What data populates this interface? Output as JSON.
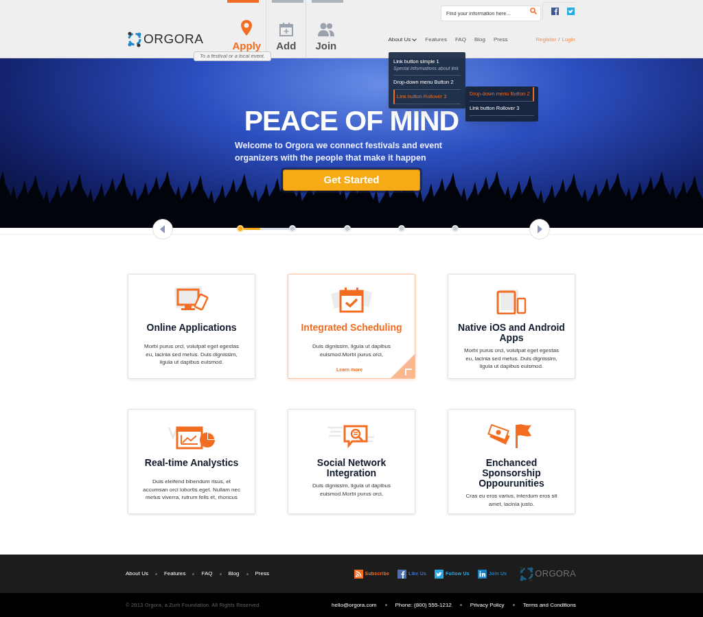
{
  "header": {
    "logo": "ORGORA",
    "actions": [
      {
        "label": "Apply",
        "selected": true
      },
      {
        "label": "Add",
        "selected": false
      },
      {
        "label": "Join",
        "selected": false
      }
    ],
    "tooltip": "To a festival or a local event.",
    "search": {
      "placeholder": "Find your information here..."
    },
    "nav": [
      {
        "label": "About Us",
        "expanded": true
      },
      {
        "label": "Features",
        "expanded": false
      },
      {
        "label": "FAQ",
        "expanded": false
      },
      {
        "label": "Blog",
        "expanded": false
      },
      {
        "label": "Press",
        "expanded": false
      }
    ],
    "auth": {
      "register": "Register",
      "separator": "/",
      "login": "Login"
    },
    "dropdown": {
      "items": [
        {
          "label": "Link button simple 1",
          "subtitle": "Special informations about link",
          "selected": false
        },
        {
          "label": "Drop-down menu Button 2",
          "selected": false
        },
        {
          "label": "Link button Rollover 3",
          "selected": true
        }
      ],
      "submenu": [
        {
          "label": "Drop-down menu Button 2",
          "selected": true
        },
        {
          "label": "Link button Rollover 3",
          "selected": false
        }
      ]
    }
  },
  "hero": {
    "title": "PEACE OF MIND",
    "subtitle": "Welcome to Orgora we connect festivals and event organizers with the people that make it happen",
    "button": "Get Started"
  },
  "slider": {
    "level": 0.37,
    "slides": [
      {
        "selected": true
      },
      {
        "selected": false
      },
      {
        "selected": false
      },
      {
        "selected": false
      },
      {
        "selected": false
      }
    ]
  },
  "features": [
    {
      "title": "Online Applications",
      "text": "Morbi purus orci, volutpat eget egestas eu, lacinia sed metus. Duis dignissim, ligula ut dapibus euismod.",
      "selected": false
    },
    {
      "title": "Integrated Scheduling",
      "text": "Duis dignissim, ligula ut dapibus euismod.Morbi purus orci,",
      "link": "Learn more",
      "selected": true
    },
    {
      "title": "Native iOS and Android Apps",
      "text": "Morbi purus orci, volutpat eget egestas eu, lacinia sed metus. Duis dignissim, ligula ut dapibus euismod.",
      "selected": false
    },
    {
      "title": "Real-time Analystics",
      "text": "Duis eleifend bibendum risus, et accumsan orci lobortis eget. Nullam nec metus viverra, rutrum felis et, rhoncus",
      "selected": false
    },
    {
      "title": "Social Network Integration",
      "text": "Duis dignissim, ligula ut dapibus euismod.Morbi purus orci,",
      "selected": false
    },
    {
      "title": "Enchanced Sponsorship Oppourunities",
      "text": "Cras eu eros varius, interdum eros sit amet, lacinia justo.",
      "selected": false
    }
  ],
  "footer": {
    "nav": [
      "About Us",
      "Features",
      "FAQ",
      "Blog",
      "Press"
    ],
    "social": [
      {
        "kind": "rss",
        "label": "Subscribe",
        "color": "#f26d21"
      },
      {
        "kind": "facebook",
        "label": "Like Us",
        "color": "#4a6fb5"
      },
      {
        "kind": "twitter",
        "label": "Follow Us",
        "color": "#29a9e1"
      },
      {
        "kind": "linkedin",
        "label": "Join Us",
        "color": "#1b7fc4"
      }
    ],
    "logo": "ORGORA",
    "copyright": "© 2013 Orgora, a Zurb Foundation. All Rights Reserved.",
    "contacts": [
      "hello@orgora.com",
      "Phone: (800) 555-1212",
      "Privacy Policy",
      "Terms and Conditions"
    ]
  }
}
